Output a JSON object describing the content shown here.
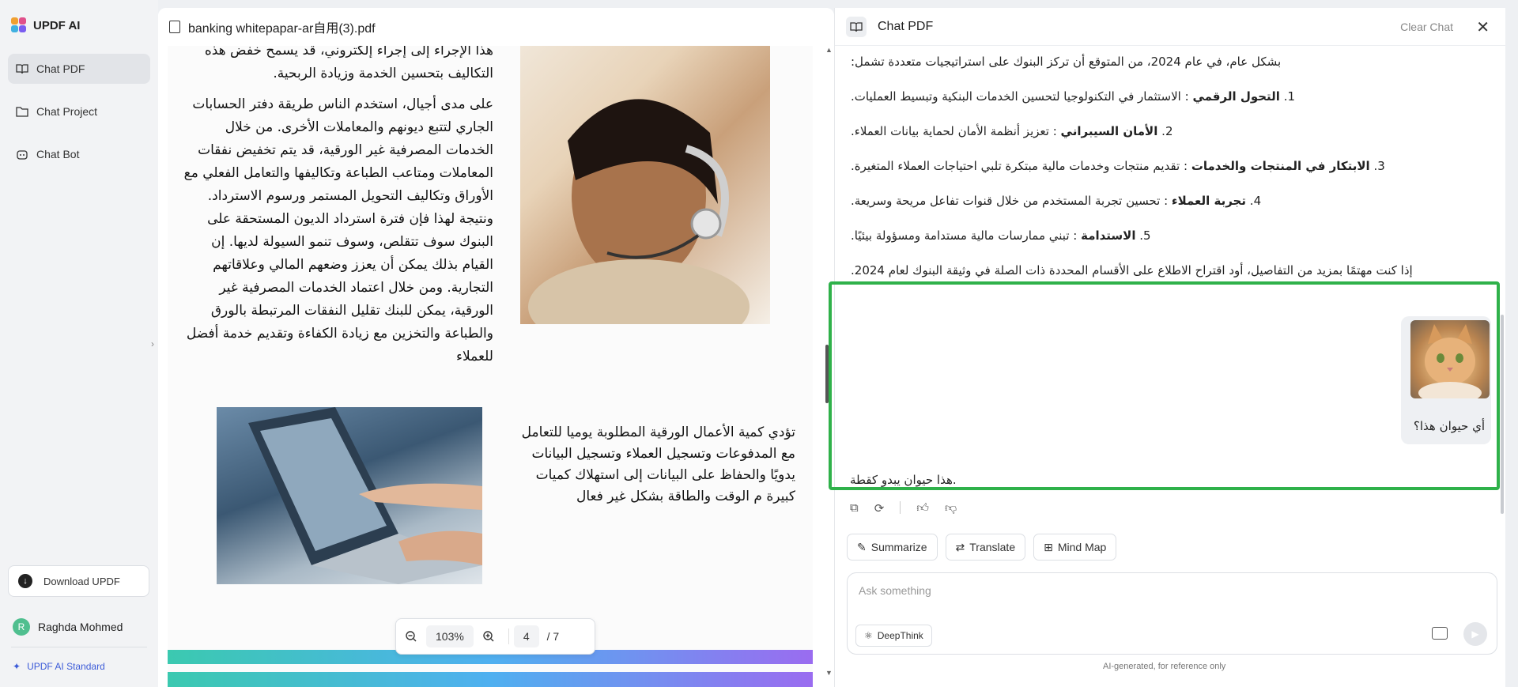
{
  "sidebar": {
    "app_name": "UPDF AI",
    "items": [
      {
        "label": "Chat PDF",
        "icon": "book-icon"
      },
      {
        "label": "Chat Project",
        "icon": "folder-icon"
      },
      {
        "label": "Chat Bot",
        "icon": "bot-icon"
      }
    ],
    "download_label": "Download UPDF",
    "user_initial": "R",
    "user_name": "Raghda Mohmed",
    "plan_label": "UPDF AI Standard"
  },
  "viewer": {
    "file_name": "banking whitepapar-ar自用(3).pdf",
    "para_top": "هذا الإجراء إلى إجراء إلكتروني، قد يسمح خفض هذه التكاليف بتحسين الخدمة وزيادة الربحية.",
    "para_main": "على مدى أجيال، استخدم الناس طريقة دفتر الحسابات الجاري لتتبع ديونهم والمعاملات الأخرى. من خلال الخدمات المصرفية غير الورقية، قد يتم تخفيض نفقات المعاملات ومتاعب الطباعة وتكاليفها والتعامل الفعلي مع الأوراق وتكاليف التحويل المستمر ورسوم الاسترداد. ونتيجة لهذا فإن فترة استرداد الديون المستحقة على البنوك سوف تتقلص، وسوف تنمو السيولة لديها. إن القيام بذلك يمكن أن يعزز وضعهم المالي وعلاقاتهم التجارية. ومن خلال اعتماد الخدمات المصرفية غير الورقية، يمكن للبنك تقليل النفقات المرتبطة بالورق والطباعة والتخزين مع زيادة الكفاءة وتقديم خدمة أفضل للعملاء",
    "para_side": "تؤدي كمية الأعمال الورقية المطلوبة يوميا للتعامل مع المدفوعات وتسجيل العملاء وتسجيل البيانات يدويًا والحفاظ على البيانات إلى استهلاك كميات كبيرة م الوقت والطاقة بشكل غير فعال",
    "zoom": "103%",
    "page_current": "4",
    "page_total": "/ 7"
  },
  "chat": {
    "title": "Chat PDF",
    "clear_label": "Clear Chat",
    "intro": "بشكل عام، في عام 2024، من المتوقع أن تركز البنوك على استراتيجيات متعددة تشمل:",
    "items": [
      {
        "num": "1.",
        "bold": "التحول الرقمي",
        "text": " : الاستثمار في التكنولوجيا لتحسين الخدمات البنكية وتبسيط العمليات."
      },
      {
        "num": "2.",
        "bold": "الأمان السيبراني",
        "text": " : تعزيز أنظمة الأمان لحماية بيانات العملاء."
      },
      {
        "num": "3.",
        "bold": "الابتكار في المنتجات والخدمات",
        "text": " : تقديم منتجات وخدمات مالية مبتكرة تلبي احتياجات العملاء المتغيرة."
      },
      {
        "num": "4.",
        "bold": "تجربة العملاء",
        "text": " : تحسين تجربة المستخدم من خلال قنوات تفاعل مريحة وسريعة."
      },
      {
        "num": "5.",
        "bold": "الاستدامة",
        "text": " : تبني ممارسات مالية مستدامة ومسؤولة بيئيًا."
      }
    ],
    "closing": "إذا كنت مهتمًا بمزيد من التفاصيل، أود اقتراح الاطلاع على الأقسام المحددة ذات الصلة في وثيقة البنوك لعام 2024.",
    "user_question": "أي حيوان هذا؟",
    "answer": "هذا حيوان يبدو كقطة.",
    "quick_actions": [
      "Summarize",
      "Translate",
      "Mind Map"
    ],
    "input_placeholder": "Ask something",
    "deepthink_label": "DeepThink",
    "footnote": "AI-generated, for reference only"
  },
  "colors": {
    "highlight": "#2fb14a",
    "plan_text": "#3c5bd8",
    "avatar": "#4fbf8f"
  }
}
